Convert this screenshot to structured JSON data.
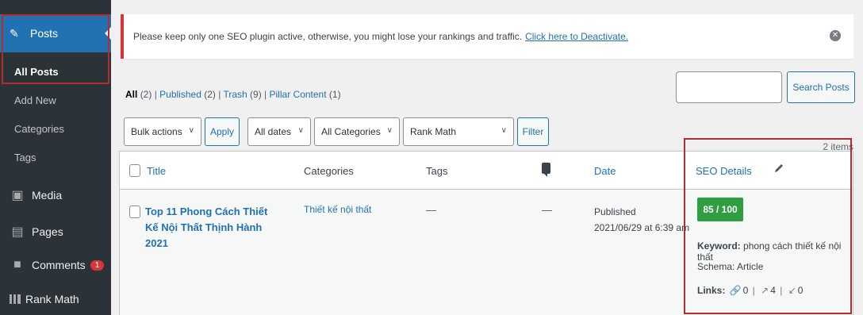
{
  "sidebar": {
    "posts_label": "Posts",
    "submenu": [
      {
        "label": "All Posts",
        "current": true
      },
      {
        "label": "Add New",
        "current": false
      },
      {
        "label": "Categories",
        "current": false
      },
      {
        "label": "Tags",
        "current": false
      }
    ],
    "menu": [
      {
        "label": "Media",
        "icon": "media-icon"
      },
      {
        "label": "Pages",
        "icon": "pages-icon"
      },
      {
        "label": "Comments",
        "icon": "comments-icon",
        "badge": "1"
      },
      {
        "label": "Rank Math",
        "icon": "rank-math-icon"
      }
    ]
  },
  "notice": {
    "text": "Please keep only one SEO plugin active, otherwise, you might lose your rankings and traffic.",
    "link": "Click here to Deactivate."
  },
  "filters": {
    "all": "All",
    "all_count": "(2)",
    "published": "Published",
    "published_count": "(2)",
    "trash": "Trash",
    "trash_count": "(9)",
    "pillar": "Pillar Content",
    "pillar_count": "(1)"
  },
  "search": {
    "button": "Search Posts",
    "value": ""
  },
  "toolbar": {
    "bulk": "Bulk actions",
    "apply": "Apply",
    "dates": "All dates",
    "categories": "All Categories",
    "rankmath": "Rank Math",
    "filter": "Filter",
    "items": "2 items"
  },
  "table": {
    "headers": {
      "title": "Title",
      "categories": "Categories",
      "tags": "Tags",
      "date": "Date",
      "seo": "SEO Details"
    },
    "row": {
      "title": "Top 11 Phong Cách Thiết Kế Nội Thất Thịnh Hành 2021",
      "category": "Thiết kế nội thất",
      "tags": "—",
      "comments": "—",
      "status": "Published",
      "date": "2021/06/29 at 6:39 am",
      "score": "85 / 100",
      "keyword_label": "Keyword:",
      "keyword": "phong cách thiết kế nội thất",
      "schema_label": "Schema:",
      "schema": "Article",
      "links_label": "Links:",
      "internal": "0",
      "external": "4",
      "incoming": "0"
    }
  },
  "colors": {
    "accent": "#2271b1",
    "sidebar": "#2c3338",
    "score": "#2e9e41",
    "highlight": "#b32d2e"
  }
}
